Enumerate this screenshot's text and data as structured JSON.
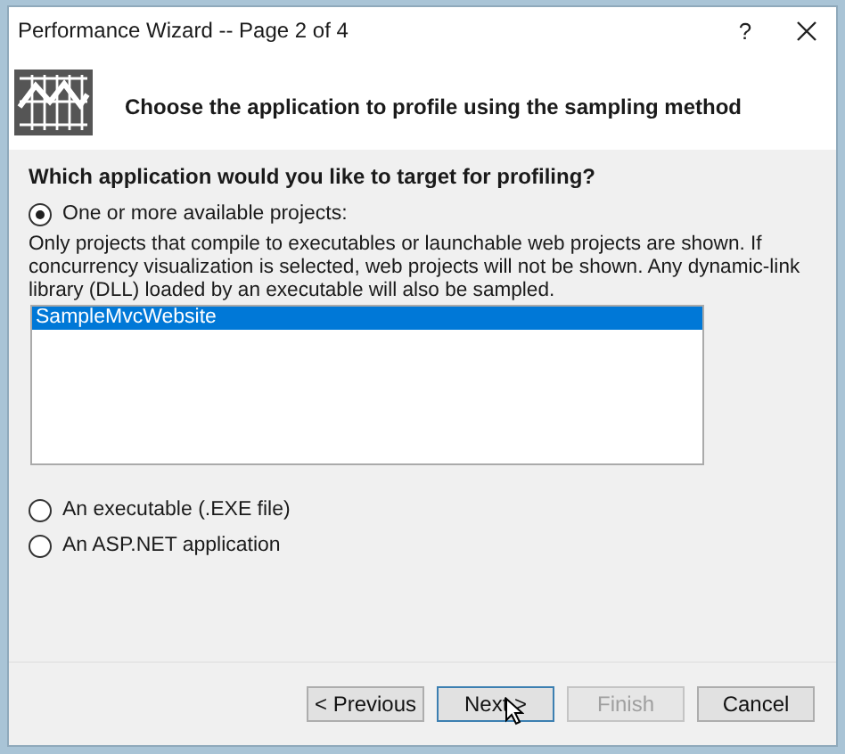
{
  "window": {
    "title": "Performance Wizard -- Page 2 of 4",
    "help": "?"
  },
  "header": {
    "heading": "Choose the application to profile using the sampling method"
  },
  "question": "Which application would you like to target for profiling?",
  "options": [
    {
      "label": "One or more available projects:",
      "selected": true,
      "description": "Only projects that compile to executables or launchable web projects are shown. If concurrency visualization is selected, web projects will not be shown. Any dynamic-link library (DLL) loaded by an executable will also be sampled.",
      "projects": [
        {
          "name": "SampleMvcWebsite",
          "selected": true
        }
      ]
    },
    {
      "label": "An executable (.EXE file)",
      "selected": false
    },
    {
      "label": "An ASP.NET application",
      "selected": false
    }
  ],
  "buttons": [
    {
      "label": "< Previous",
      "disabled": false,
      "focused": false
    },
    {
      "label": "Next >",
      "disabled": false,
      "focused": true
    },
    {
      "label": "Finish",
      "disabled": true,
      "focused": false
    },
    {
      "label": "Cancel",
      "disabled": false,
      "focused": false
    }
  ]
}
